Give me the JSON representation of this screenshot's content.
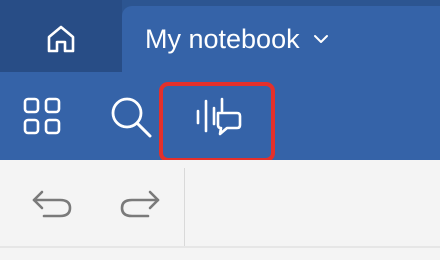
{
  "tabs": {
    "home_icon": "home-icon",
    "notebook_title": "My notebook",
    "notebook_dropdown_icon": "chevron-down-icon"
  },
  "toolbar": {
    "items": [
      "grid-view-icon",
      "search-icon",
      "gesture-assist-icon"
    ],
    "highlighted_item": "gesture-assist-icon"
  },
  "ribbon": {
    "items": [
      "undo-icon",
      "redo-icon"
    ]
  },
  "colors": {
    "header_dark": "#284d86",
    "header": "#3563a8",
    "highlight": "#e4302b",
    "ribbon": "#f4f4f4",
    "icon_gray": "#7a7a7a"
  }
}
